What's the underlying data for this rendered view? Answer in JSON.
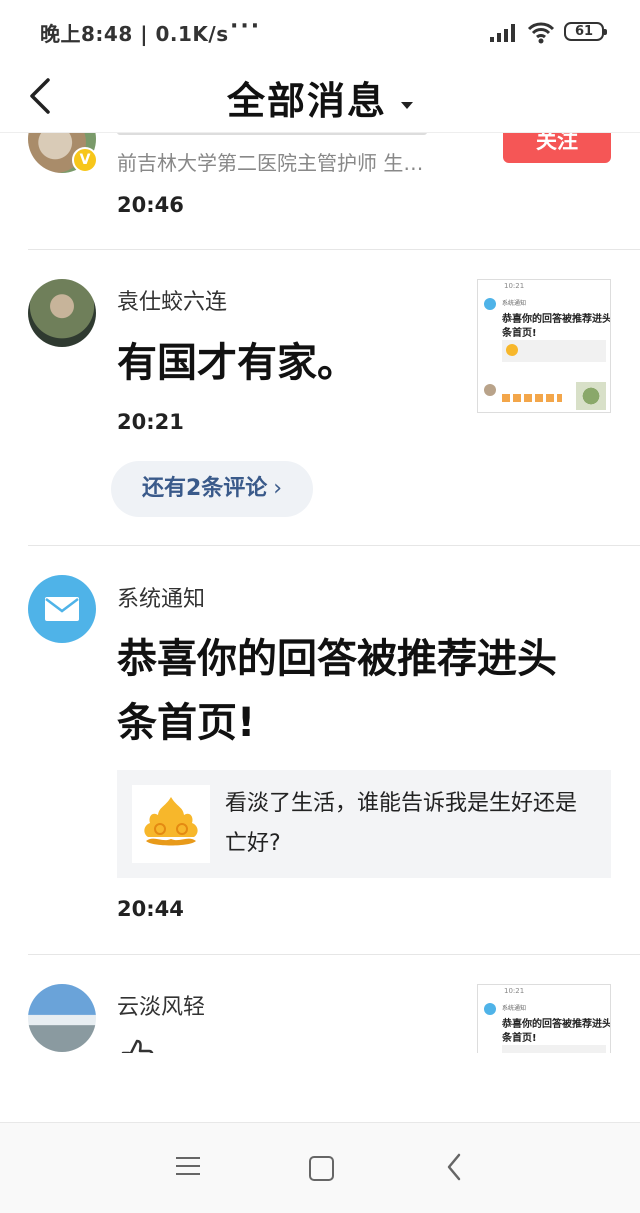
{
  "status_bar": {
    "time_speed": "晚上8:48 | 0.1K/s",
    "dots": "···",
    "battery": "61"
  },
  "header": {
    "title": "全部消息"
  },
  "items": [
    {
      "name_partial": "",
      "subtitle": "前吉林大学第二医院主管护师 生…",
      "follow": "关注",
      "time": "20:46",
      "badge": "V"
    },
    {
      "name": "袁仕蛟六连",
      "text": "有国才有家。",
      "time": "20:21",
      "more_comments": "还有2条评论"
    },
    {
      "name": "系统通知",
      "text_line1": "恭喜你的回答被推荐进头",
      "text_line2": "条首页!",
      "quote": "看淡了生活，谁能告诉我是生好还是亡好?",
      "time": "20:44"
    },
    {
      "name": "云淡风轻"
    }
  ],
  "thumb": {
    "time": "10:21",
    "sender": "系统通知",
    "line1": "恭喜你的回答被推荐进头",
    "line2": "条首页!"
  },
  "colors": {
    "accent_red": "#f55656",
    "link_blue": "#3a5a8a",
    "mail_blue": "#4fb3e8",
    "gold": "#f7b72b"
  }
}
